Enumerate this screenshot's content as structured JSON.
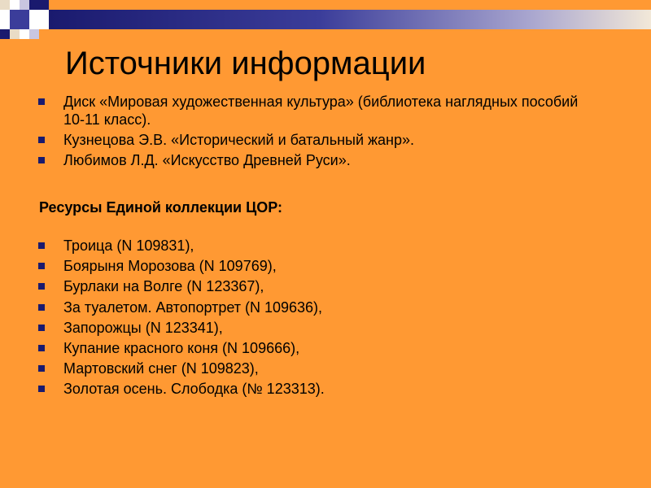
{
  "slide": {
    "title": "Источники информации",
    "sources": [
      "Диск «Мировая художественная культура» (библиотека наглядных пособий 10-11 класс).",
      "Кузнецова Э.В. «Исторический и батальный жанр».",
      "Любимов Л.Д. «Искусство Древней Руси»."
    ],
    "resources_heading": "Ресурсы Единой коллекции ЦОР:",
    "resources": [
      "Троица (N 109831),",
      "Боярыня Морозова (N 109769),",
      "Бурлаки на Волге (N 123367),",
      "За туалетом. Автопортрет (N 109636),",
      "Запорожцы (N 123341),",
      "Купание красного коня (N 109666),",
      "Мартовский снег (N 109823),",
      "Золотая осень. Слободка (№ 123313)."
    ]
  },
  "colors": {
    "background": "#FF9933",
    "bullet": "#1A1A6E",
    "band_dark": "#1A1A6E",
    "band_light": "#F2E8D8"
  }
}
